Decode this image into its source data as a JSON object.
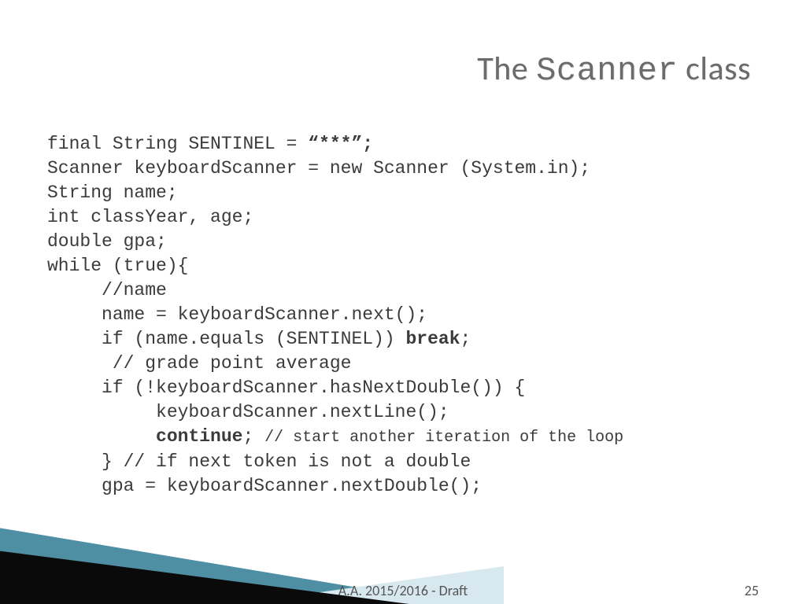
{
  "title": {
    "pre": "The ",
    "mono": "Scanner",
    "post": " class"
  },
  "code": {
    "l1a": "final String SENTINEL = ",
    "l1b": "“***”;",
    "l2": "Scanner keyboardScanner = new Scanner (System.in);",
    "l3": "String name;",
    "l4": "int classYear, age;",
    "l5": "double gpa;",
    "l6": "while (true){",
    "l7": "     //name",
    "l8": "     name = keyboardScanner.next();",
    "l9a": "     if (name.equals (SENTINEL)) ",
    "l9b": "break",
    "l9c": ";",
    "l10": "      // grade point average",
    "l11": "     if (!keyboardScanner.hasNextDouble()) {",
    "l12": "          keyboardScanner.nextLine();",
    "l13a": "          ",
    "l13b": "continue",
    "l13c": "; ",
    "l13d": "// start another iteration of the loop",
    "l14": "     } // if next token is not a double",
    "l15": "     gpa = keyboardScanner.nextDouble();"
  },
  "footer": {
    "center": "A.A. 2015/2016  -  Draft",
    "page": "25"
  }
}
